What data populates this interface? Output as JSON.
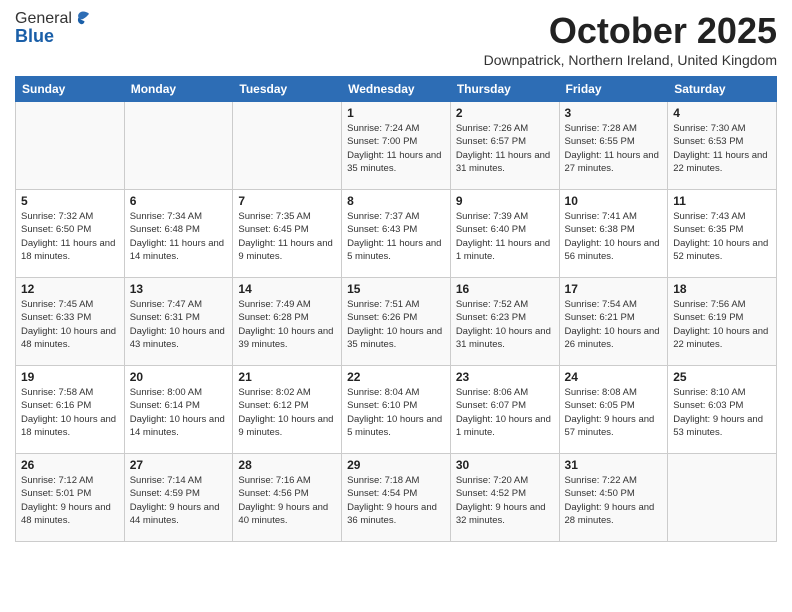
{
  "header": {
    "logo_general": "General",
    "logo_blue": "Blue",
    "month": "October 2025",
    "location": "Downpatrick, Northern Ireland, United Kingdom"
  },
  "days_of_week": [
    "Sunday",
    "Monday",
    "Tuesday",
    "Wednesday",
    "Thursday",
    "Friday",
    "Saturday"
  ],
  "weeks": [
    [
      {
        "day": "",
        "info": ""
      },
      {
        "day": "",
        "info": ""
      },
      {
        "day": "",
        "info": ""
      },
      {
        "day": "1",
        "info": "Sunrise: 7:24 AM\nSunset: 7:00 PM\nDaylight: 11 hours and 35 minutes."
      },
      {
        "day": "2",
        "info": "Sunrise: 7:26 AM\nSunset: 6:57 PM\nDaylight: 11 hours and 31 minutes."
      },
      {
        "day": "3",
        "info": "Sunrise: 7:28 AM\nSunset: 6:55 PM\nDaylight: 11 hours and 27 minutes."
      },
      {
        "day": "4",
        "info": "Sunrise: 7:30 AM\nSunset: 6:53 PM\nDaylight: 11 hours and 22 minutes."
      }
    ],
    [
      {
        "day": "5",
        "info": "Sunrise: 7:32 AM\nSunset: 6:50 PM\nDaylight: 11 hours and 18 minutes."
      },
      {
        "day": "6",
        "info": "Sunrise: 7:34 AM\nSunset: 6:48 PM\nDaylight: 11 hours and 14 minutes."
      },
      {
        "day": "7",
        "info": "Sunrise: 7:35 AM\nSunset: 6:45 PM\nDaylight: 11 hours and 9 minutes."
      },
      {
        "day": "8",
        "info": "Sunrise: 7:37 AM\nSunset: 6:43 PM\nDaylight: 11 hours and 5 minutes."
      },
      {
        "day": "9",
        "info": "Sunrise: 7:39 AM\nSunset: 6:40 PM\nDaylight: 11 hours and 1 minute."
      },
      {
        "day": "10",
        "info": "Sunrise: 7:41 AM\nSunset: 6:38 PM\nDaylight: 10 hours and 56 minutes."
      },
      {
        "day": "11",
        "info": "Sunrise: 7:43 AM\nSunset: 6:35 PM\nDaylight: 10 hours and 52 minutes."
      }
    ],
    [
      {
        "day": "12",
        "info": "Sunrise: 7:45 AM\nSunset: 6:33 PM\nDaylight: 10 hours and 48 minutes."
      },
      {
        "day": "13",
        "info": "Sunrise: 7:47 AM\nSunset: 6:31 PM\nDaylight: 10 hours and 43 minutes."
      },
      {
        "day": "14",
        "info": "Sunrise: 7:49 AM\nSunset: 6:28 PM\nDaylight: 10 hours and 39 minutes."
      },
      {
        "day": "15",
        "info": "Sunrise: 7:51 AM\nSunset: 6:26 PM\nDaylight: 10 hours and 35 minutes."
      },
      {
        "day": "16",
        "info": "Sunrise: 7:52 AM\nSunset: 6:23 PM\nDaylight: 10 hours and 31 minutes."
      },
      {
        "day": "17",
        "info": "Sunrise: 7:54 AM\nSunset: 6:21 PM\nDaylight: 10 hours and 26 minutes."
      },
      {
        "day": "18",
        "info": "Sunrise: 7:56 AM\nSunset: 6:19 PM\nDaylight: 10 hours and 22 minutes."
      }
    ],
    [
      {
        "day": "19",
        "info": "Sunrise: 7:58 AM\nSunset: 6:16 PM\nDaylight: 10 hours and 18 minutes."
      },
      {
        "day": "20",
        "info": "Sunrise: 8:00 AM\nSunset: 6:14 PM\nDaylight: 10 hours and 14 minutes."
      },
      {
        "day": "21",
        "info": "Sunrise: 8:02 AM\nSunset: 6:12 PM\nDaylight: 10 hours and 9 minutes."
      },
      {
        "day": "22",
        "info": "Sunrise: 8:04 AM\nSunset: 6:10 PM\nDaylight: 10 hours and 5 minutes."
      },
      {
        "day": "23",
        "info": "Sunrise: 8:06 AM\nSunset: 6:07 PM\nDaylight: 10 hours and 1 minute."
      },
      {
        "day": "24",
        "info": "Sunrise: 8:08 AM\nSunset: 6:05 PM\nDaylight: 9 hours and 57 minutes."
      },
      {
        "day": "25",
        "info": "Sunrise: 8:10 AM\nSunset: 6:03 PM\nDaylight: 9 hours and 53 minutes."
      }
    ],
    [
      {
        "day": "26",
        "info": "Sunrise: 7:12 AM\nSunset: 5:01 PM\nDaylight: 9 hours and 48 minutes."
      },
      {
        "day": "27",
        "info": "Sunrise: 7:14 AM\nSunset: 4:59 PM\nDaylight: 9 hours and 44 minutes."
      },
      {
        "day": "28",
        "info": "Sunrise: 7:16 AM\nSunset: 4:56 PM\nDaylight: 9 hours and 40 minutes."
      },
      {
        "day": "29",
        "info": "Sunrise: 7:18 AM\nSunset: 4:54 PM\nDaylight: 9 hours and 36 minutes."
      },
      {
        "day": "30",
        "info": "Sunrise: 7:20 AM\nSunset: 4:52 PM\nDaylight: 9 hours and 32 minutes."
      },
      {
        "day": "31",
        "info": "Sunrise: 7:22 AM\nSunset: 4:50 PM\nDaylight: 9 hours and 28 minutes."
      },
      {
        "day": "",
        "info": ""
      }
    ]
  ]
}
